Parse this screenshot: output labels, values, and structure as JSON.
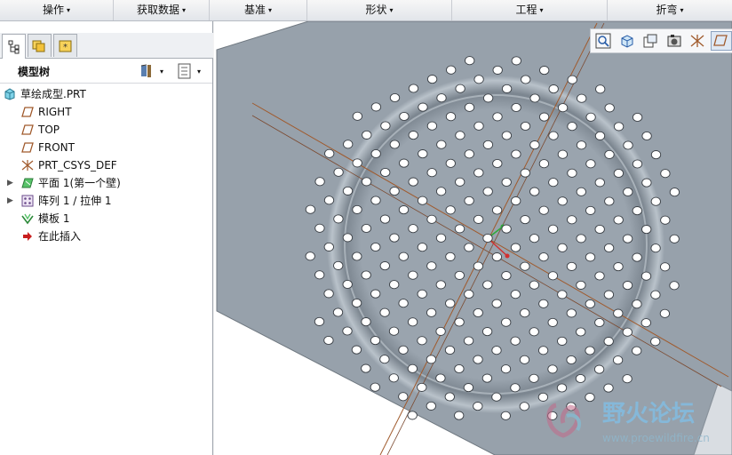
{
  "menu": [
    {
      "label": "操作"
    },
    {
      "label": "获取数据"
    },
    {
      "label": "基准"
    },
    {
      "label": "形状"
    },
    {
      "label": "工程"
    },
    {
      "label": "折弯"
    }
  ],
  "menu_arrow": "▾",
  "panel_tabs": [
    "model-tree-tab",
    "layer-tab",
    "favorites-tab"
  ],
  "model_tree": {
    "title": "模型树",
    "settings_icon": "tree-settings-icon",
    "show_icon": "tree-show-icon",
    "items": [
      {
        "label": "草绘成型.PRT",
        "icon": "part-icon",
        "expandable": false
      },
      {
        "label": "RIGHT",
        "icon": "datum-plane-icon",
        "expandable": false
      },
      {
        "label": "TOP",
        "icon": "datum-plane-icon",
        "expandable": false
      },
      {
        "label": "FRONT",
        "icon": "datum-plane-icon",
        "expandable": false
      },
      {
        "label": "PRT_CSYS_DEF",
        "icon": "csys-icon",
        "expandable": false
      },
      {
        "label": "平面 1(第一个壁)",
        "icon": "flat-wall-icon",
        "expandable": true
      },
      {
        "label": "阵列 1 / 拉伸 1",
        "icon": "pattern-icon",
        "expandable": true
      },
      {
        "label": "模板 1",
        "icon": "form-icon",
        "expandable": false
      },
      {
        "label": "在此插入",
        "icon": "insert-arrow-icon",
        "expandable": false
      }
    ]
  },
  "view_toolbar": [
    "zoom-fit-icon",
    "view-orientation-icon",
    "saved-views-icon",
    "display-style-icon",
    "datum-display-icon",
    "annotation-display-icon"
  ],
  "watermark": {
    "title": "野火论坛",
    "url": "www.proewildfire.cn"
  },
  "colors": {
    "sheet": "#97a1ab",
    "sheet_dark": "#7f8993",
    "datum_line": "#a05a2c",
    "background": "#ffffff"
  }
}
